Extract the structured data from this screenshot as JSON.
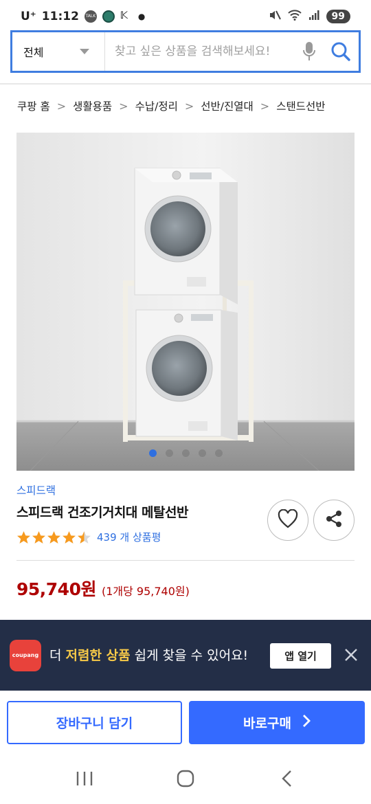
{
  "status_bar": {
    "carrier": "U⁺",
    "time": "11:12",
    "battery": "99"
  },
  "search": {
    "category": "전체",
    "placeholder": "찾고 싶은 상품을 검색해보세요!",
    "value": ""
  },
  "breadcrumb": [
    "쿠팡 홈",
    "생활용품",
    "수납/정리",
    "선반/진열대",
    "스탠드선반"
  ],
  "breadcrumb_separator": ">",
  "carousel": {
    "total_images": 5,
    "active_index": 0
  },
  "product": {
    "brand": "스피드랙",
    "title": "스피드랙 건조기거치대 메탈선반",
    "rating": 4.5,
    "review_count": "439 개 상품평",
    "price": "95,740원",
    "unit_price": "(1개당 95,740원)"
  },
  "app_banner": {
    "text_prefix": "더 ",
    "text_highlight": "저렴한 상품",
    "text_suffix": " 쉽게 찾을 수 있어요!",
    "logo_text": "coupang",
    "open_button": "앱 열기"
  },
  "buttons": {
    "cart": "장바구니 담기",
    "buy_now": "바로구매"
  },
  "colors": {
    "accent_blue": "#346aff",
    "search_border": "#3f7de0",
    "price_red": "#ae0000",
    "star_orange": "#f79a1e",
    "banner_bg": "#232e47",
    "banner_highlight": "#f7c948"
  }
}
